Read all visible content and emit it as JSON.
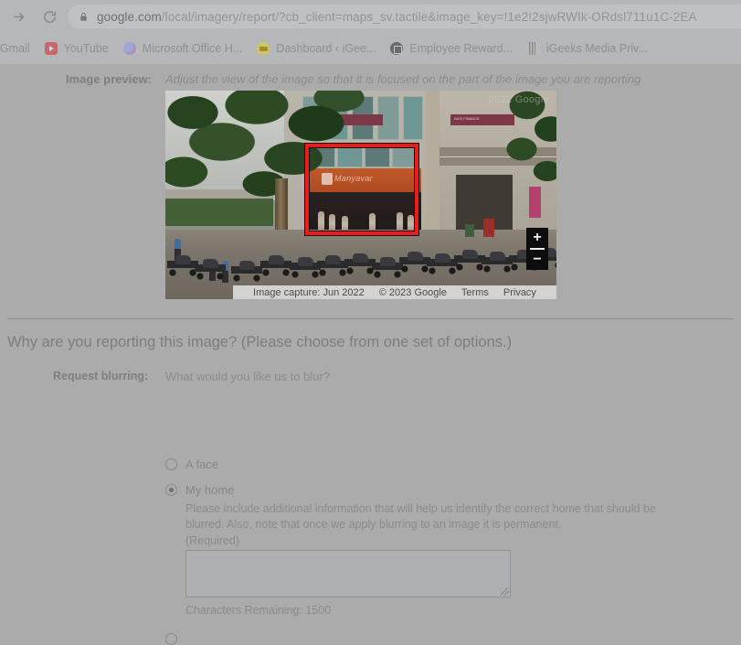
{
  "browser": {
    "nav": {
      "forward_icon": "arrow-right-icon",
      "reload_icon": "reload-icon"
    },
    "omnibox": {
      "lock_icon": "lock-icon",
      "host": "google.com",
      "path": "/local/imagery/report/?cb_client=maps_sv.tactile&image_key=!1e2!2sjwRWIk-ORdsl711u1C-2EA"
    },
    "bookmarks": [
      {
        "label": "Gmail",
        "icon": "gmail-icon"
      },
      {
        "label": "YouTube",
        "icon": "youtube-icon"
      },
      {
        "label": "Microsoft Office H...",
        "icon": "microsoft-office-icon"
      },
      {
        "label": "Dashboard ‹ iGee...",
        "icon": "dashboard-icon"
      },
      {
        "label": "Employee Reward...",
        "icon": "employee-rewards-icon"
      },
      {
        "label": "iGeeks Media Priv...",
        "icon": "igeeks-media-icon"
      }
    ]
  },
  "preview": {
    "label": "Image preview:",
    "instruction": "Adjust the view of the image so that it is focused on the part of the image you are reporting",
    "watermark": "2022 Google",
    "zoom_in_label": "+",
    "zoom_out_label": "−",
    "attribution": {
      "capture": "Image capture: Jun 2022",
      "copyright": "© 2023 Google",
      "terms": "Terms",
      "privacy": "Privacy"
    }
  },
  "form": {
    "heading": "Why are you reporting this image?  (Please choose from one set of options.)",
    "blur_section_label": "Request blurring:",
    "blur_question": "What would you like us to blur?",
    "options": [
      {
        "label": "A face",
        "selected": false
      },
      {
        "label": "My home",
        "selected": true
      }
    ],
    "home_help": "Please include additional information that will help us identify the correct home that should be blurred. Also, note that once we apply blurring to an image it is permanent.",
    "home_required": "(Required)",
    "home_textarea_value": "",
    "home_textarea_placeholder": "",
    "chars_remaining": "Characters Remaining: 1500"
  }
}
